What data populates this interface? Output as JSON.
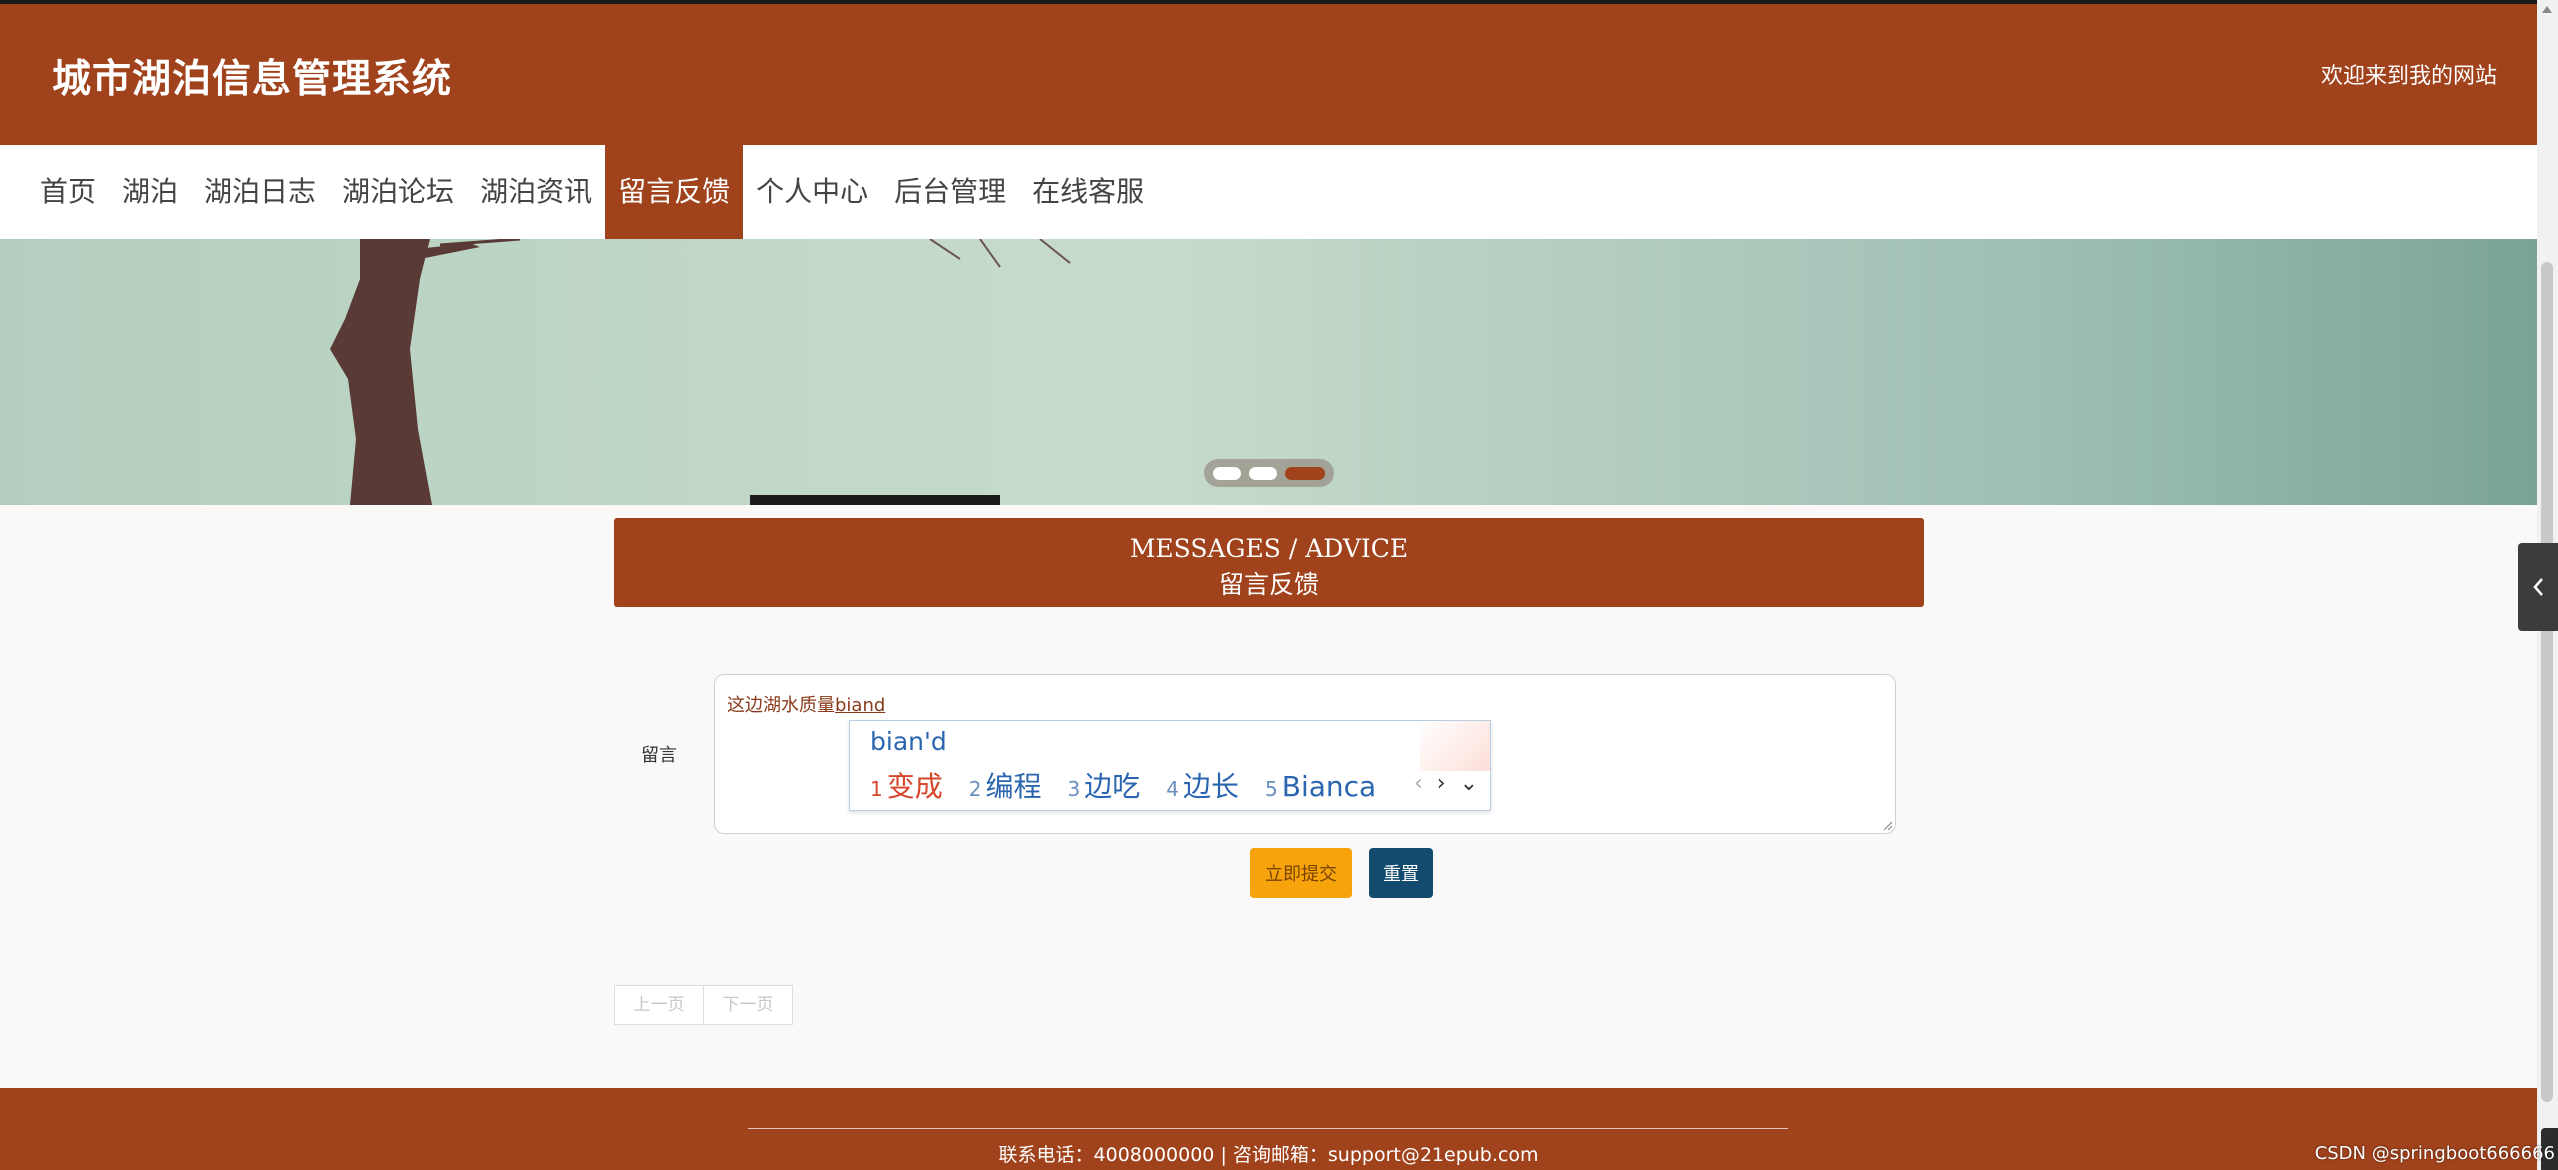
{
  "header": {
    "title": "城市湖泊信息管理系统",
    "welcome": "欢迎来到我的网站"
  },
  "nav": {
    "items": [
      {
        "label": "首页"
      },
      {
        "label": "湖泊"
      },
      {
        "label": "湖泊日志"
      },
      {
        "label": "湖泊论坛"
      },
      {
        "label": "湖泊资讯"
      },
      {
        "label": "留言反馈"
      },
      {
        "label": "个人中心"
      },
      {
        "label": "后台管理"
      },
      {
        "label": "在线客服"
      }
    ],
    "active": "留言反馈"
  },
  "carousel": {
    "slide_count": 3,
    "active_index": 3
  },
  "section": {
    "title_en": "MESSAGES / ADVICE",
    "title_cn": "留言反馈"
  },
  "form": {
    "label": "留言",
    "typed_text": "这边湖水质量",
    "composing_text": "biand",
    "submit_label": "立即提交",
    "reset_label": "重置"
  },
  "ime": {
    "composition": "bian'd",
    "candidates": [
      {
        "num": "1",
        "text": "变成"
      },
      {
        "num": "2",
        "text": "编程"
      },
      {
        "num": "3",
        "text": "边吃"
      },
      {
        "num": "4",
        "text": "边长"
      },
      {
        "num": "5",
        "text": "Bianca"
      }
    ],
    "prev_icon": "chevron-left-icon",
    "next_icon": "chevron-right-icon",
    "expand_icon": "chevron-down-icon"
  },
  "pager": {
    "prev_label": "上一页",
    "next_label": "下一页"
  },
  "footer": {
    "contact": "联系电话：4008000000 | 咨询邮箱：support@21epub.com"
  },
  "watermark": "CSDN @springboot666666",
  "colors": {
    "brand": "#a0421b",
    "submit": "#f7a30c",
    "reset": "#134b6e",
    "ime_blue": "#2a66b0",
    "ime_selected": "#d7462a"
  }
}
